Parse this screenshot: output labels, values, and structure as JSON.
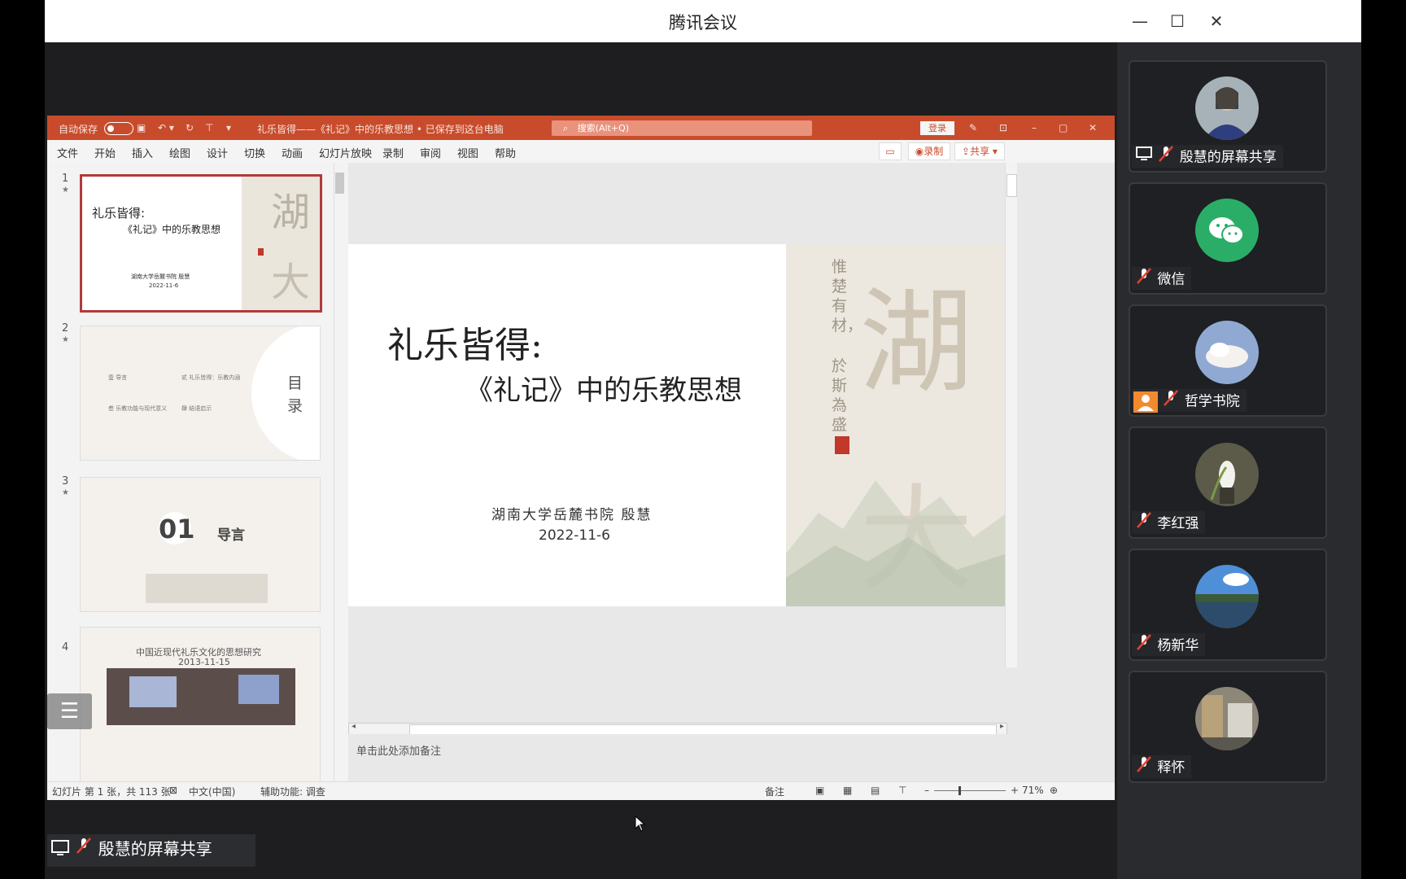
{
  "window": {
    "title": "腾讯会议"
  },
  "ppt": {
    "autosave_label": "自动保存",
    "autosave_state": "关",
    "doc_title": "礼乐皆得——《礼记》中的乐教思想 • 已保存到这台电脑",
    "search_placeholder": "搜索(Alt+Q)",
    "login_label": "登录",
    "menu": [
      "文件",
      "开始",
      "插入",
      "绘图",
      "设计",
      "切换",
      "动画",
      "幻灯片放映",
      "录制",
      "审阅",
      "视图",
      "帮助"
    ],
    "record_label": "录制",
    "share_label": "共享"
  },
  "thumbnails": [
    {
      "num": "1",
      "star": "★",
      "title": "礼乐皆得:",
      "subtitle": "《礼记》中的乐教思想",
      "author": "湖南大学岳麓书院 殷慧",
      "date": "2022-11-6"
    },
    {
      "num": "2",
      "star": "★",
      "toc_title": "目录",
      "items": [
        "壹 导言",
        "贰 礼乐皆得：乐教内涵",
        "叁 乐教功能与现代意义",
        "肆 结语启示"
      ]
    },
    {
      "num": "3",
      "star": "★",
      "section_num": "01",
      "section_title": "导言"
    },
    {
      "num": "4",
      "line1": "中国近现代礼乐文化的思想研究",
      "line2": "2013-11-15"
    }
  ],
  "slide": {
    "title": "礼乐皆得:",
    "subtitle": "《礼记》中的乐教思想",
    "author": "湖南大学岳麓书院 殷慧",
    "date": "2022-11-6",
    "big_char_1": "湖",
    "big_char_2": "大",
    "vert_text_1": "惟楚有材，",
    "vert_text_2": "於斯為盛"
  },
  "notes": {
    "placeholder": "单击此处添加备注"
  },
  "status": {
    "slide_info": "幻灯片 第 1 张，共 113 张",
    "language": "中文(中国)",
    "accessibility": "辅助功能: 调查",
    "notes_btn": "备注",
    "zoom": "71%"
  },
  "share_label": "殷慧的屏幕共享",
  "participants": [
    {
      "name": "殷慧的屏幕共享",
      "avatar": "person-photo",
      "screen_share": true
    },
    {
      "name": "微信",
      "avatar": "wechat-logo",
      "screen_share": false
    },
    {
      "name": "哲学书院",
      "avatar": "sky-photo",
      "screen_share": false
    },
    {
      "name": "李红强",
      "avatar": "flower-photo",
      "screen_share": false
    },
    {
      "name": "杨新华",
      "avatar": "lake-photo",
      "screen_share": false
    },
    {
      "name": "释怀",
      "avatar": "street-photo",
      "screen_share": false
    }
  ],
  "colors": {
    "ppt_accent": "#c84c2c",
    "selected_thumb": "#b23a3a",
    "wechat_green": "#2aae67"
  }
}
